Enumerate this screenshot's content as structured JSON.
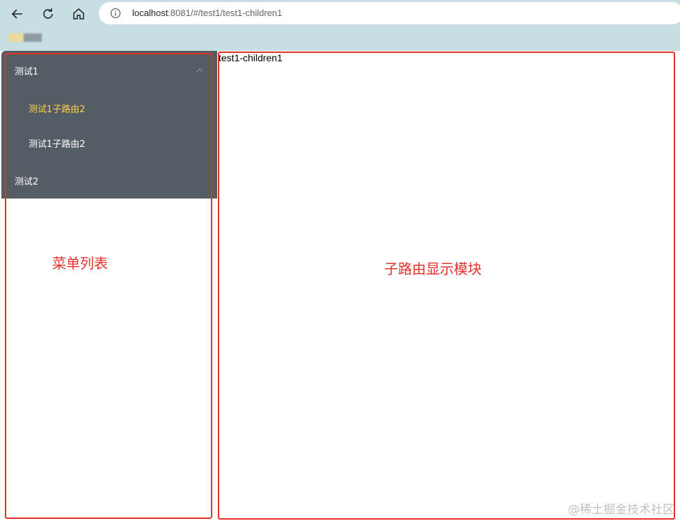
{
  "browser": {
    "url_host": "localhost",
    "url_path": ":8081/#/test1/test1-children1"
  },
  "menu": {
    "items": [
      {
        "label": "测试1"
      },
      {
        "label": "测试1子路由2",
        "active": true
      },
      {
        "label": "测试1子路由2"
      },
      {
        "label": "测试2"
      }
    ],
    "active_color": "#ffd04b",
    "background": "#545c64"
  },
  "content": {
    "text": "test1-children1"
  },
  "annotations": {
    "menu_label": "菜单列表",
    "content_label": "子路由显示模块",
    "color": "#e8302a"
  },
  "watermark": "@稀土掘金技术社区"
}
